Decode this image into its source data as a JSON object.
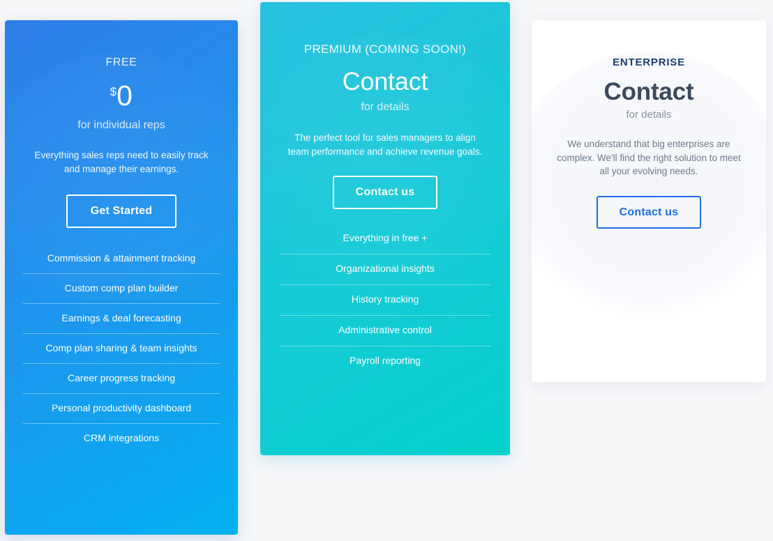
{
  "page": {
    "background_color": "#f7f8fa"
  },
  "plans": [
    {
      "id": "free",
      "name": "FREE",
      "currency": "$",
      "price": "0",
      "price_sub": "for individual reps",
      "description": "Everything sales reps need to easily track and manage their earnings.",
      "cta_label": "Get Started",
      "accent_color": "#2f7ee8",
      "gradient_end": "#04b1f0",
      "features": [
        "Commission & attainment tracking",
        "Custom comp plan builder",
        "Earnings & deal forecasting",
        "Comp plan sharing & team insights",
        "Career progress tracking",
        "Personal productivity dashboard",
        "CRM integrations"
      ]
    },
    {
      "id": "premium",
      "name": "PREMIUM (COMING SOON!)",
      "price_word": "Contact",
      "price_sub": "for details",
      "description": "The perfect tool for sales managers to align team performance and achieve revenue goals.",
      "cta_label": "Contact us",
      "accent_color": "#2ac1e0",
      "gradient_end": "#06d1cc",
      "features": [
        "Everything in free +",
        "Organizational insights",
        "History tracking",
        "Administrative control",
        "Payroll reporting"
      ]
    },
    {
      "id": "enterprise",
      "name": "ENTERPRISE",
      "price_word": "Contact",
      "price_sub": "for details",
      "description": "We understand that big enterprises are complex. We'll find the right solution to meet all your evolving needs.",
      "cta_label": "Contact us",
      "accent_color": "#1a6fe8",
      "title_color": "#1b3e72",
      "features": []
    }
  ]
}
